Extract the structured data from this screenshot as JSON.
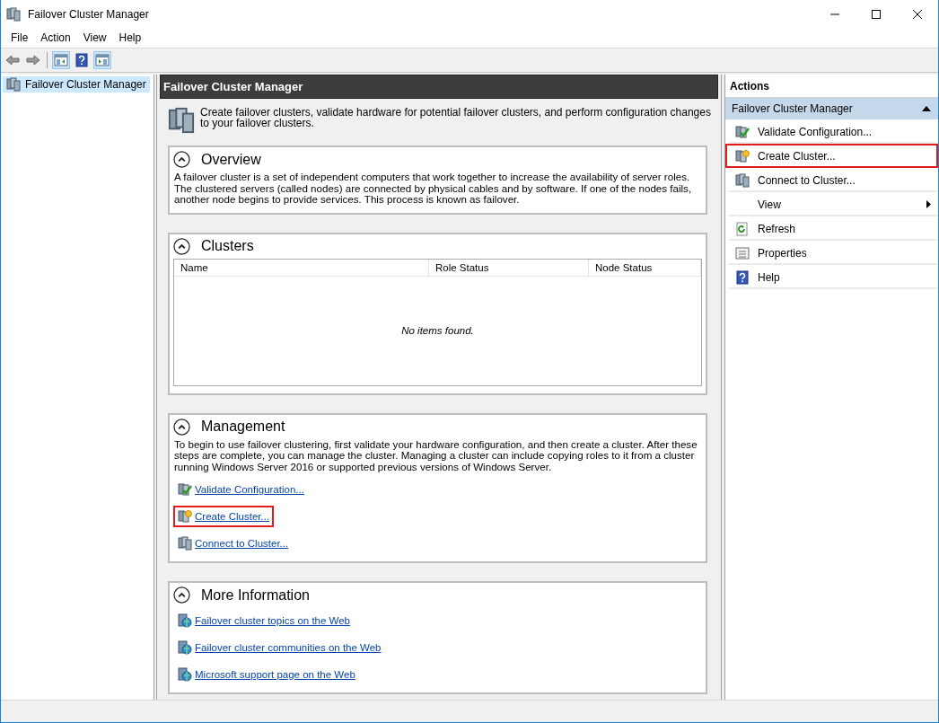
{
  "window": {
    "title": "Failover Cluster Manager"
  },
  "menu": [
    {
      "label": "File"
    },
    {
      "label": "Action"
    },
    {
      "label": "View"
    },
    {
      "label": "Help"
    }
  ],
  "toolbar": [
    {
      "kind": "back"
    },
    {
      "kind": "forward"
    },
    {
      "kind": "separator"
    },
    {
      "kind": "tree",
      "pressed": true
    },
    {
      "kind": "help"
    },
    {
      "kind": "actionpane",
      "pressed": true
    }
  ],
  "tree": [
    {
      "label": "Failover Cluster Manager",
      "selected": true
    }
  ],
  "center": {
    "title": "Failover Cluster Manager",
    "intro": "Create failover clusters, validate hardware for potential failover clusters, and perform configuration changes to your failover clusters.",
    "sections": [
      {
        "kind": "text",
        "title": "Overview",
        "expanded": true,
        "text": "A failover cluster is a set of independent computers that work together to increase the availability of server roles. The clustered servers (called nodes) are connected by physical cables and by software. If one of the nodes fails, another node begins to provide services. This process is known as failover."
      },
      {
        "kind": "table",
        "title": "Clusters",
        "expanded": true,
        "columns": [
          "Name",
          "Role Status",
          "Node Status"
        ],
        "empty_message": "No items found."
      },
      {
        "kind": "links",
        "title": "Management",
        "expanded": true,
        "text": "To begin to use failover clustering, first validate your hardware configuration, and then create a cluster.  After these steps are complete, you can manage the cluster. Managing a cluster can include copying roles to it from a cluster running Windows Server 2016 or supported previous versions of Windows Server.",
        "links": [
          {
            "label": "Validate Configuration...",
            "kind": "validate",
            "highlighted": false
          },
          {
            "label": "Create Cluster...",
            "kind": "create",
            "highlighted": true
          },
          {
            "label": "Connect to Cluster...",
            "kind": "cluster",
            "highlighted": false
          }
        ]
      },
      {
        "kind": "links",
        "title": "More Information",
        "expanded": true,
        "links": [
          {
            "label": "Failover cluster topics on the Web",
            "kind": "web",
            "highlighted": false
          },
          {
            "label": "Failover cluster communities on the Web",
            "kind": "web",
            "highlighted": false
          },
          {
            "label": "Microsoft support page on the Web",
            "kind": "web",
            "highlighted": false
          }
        ]
      }
    ]
  },
  "actions": {
    "title": "Actions",
    "group": {
      "title": "Failover Cluster Manager",
      "expanded": true
    },
    "items": [
      {
        "label": "Validate Configuration...",
        "kind": "validate",
        "highlighted": false
      },
      {
        "label": "Create Cluster...",
        "kind": "create",
        "highlighted": true
      },
      {
        "label": "Connect to Cluster...",
        "kind": "cluster",
        "highlighted": false
      },
      {
        "label": "View",
        "kind": "submenu",
        "highlighted": false
      },
      {
        "label": "Refresh",
        "kind": "refresh",
        "highlighted": false
      },
      {
        "label": "Properties",
        "kind": "properties",
        "highlighted": false
      },
      {
        "label": "Help",
        "kind": "help",
        "highlighted": false
      }
    ]
  }
}
